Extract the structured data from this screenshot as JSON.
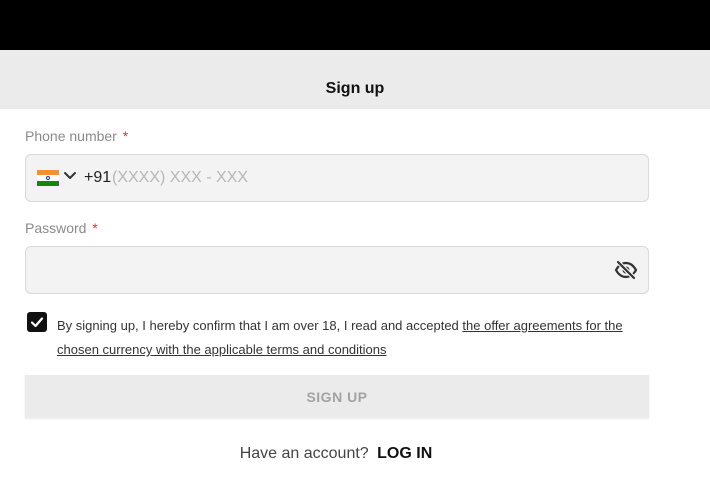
{
  "header": {
    "title": "Sign up"
  },
  "phone": {
    "label": "Phone number",
    "required_mark": "*",
    "country_icon": "india-flag-icon",
    "dropdown_icon": "chevron-down-icon",
    "code": "+91",
    "placeholder": "(XXXX) XXX - XXX",
    "value": ""
  },
  "password": {
    "label": "Password",
    "required_mark": "*",
    "value": "",
    "toggle_icon": "eye-slash-icon"
  },
  "terms": {
    "checked": true,
    "text": "By signing up, I hereby confirm that I am over 18, I read and accepted ",
    "link": "the offer agreements for the chosen currency with the applicable terms and conditions"
  },
  "signup_button": {
    "label": "SIGN UP"
  },
  "footer": {
    "prompt": "Have an account?",
    "login_label": "LOG IN"
  },
  "colors": {
    "topbar": "#000000",
    "titlebar": "#ebebeb",
    "required": "#d23a3a",
    "checkbox": "#111111"
  }
}
